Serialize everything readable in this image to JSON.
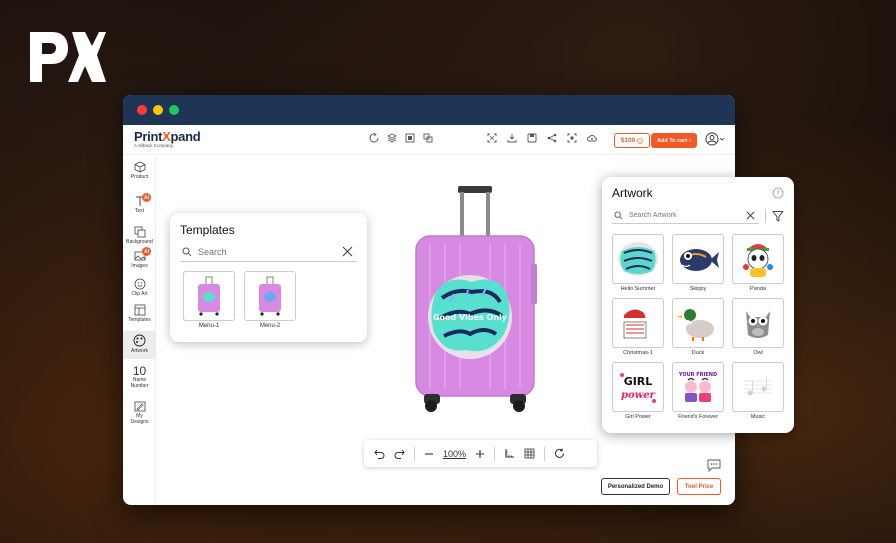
{
  "brand": {
    "name_prefix": "Print",
    "name_x": "X",
    "name_suffix": "pand",
    "sub": "A Silback Company",
    "accent": "#f15a24",
    "navy": "#1e3556"
  },
  "toolbar": {
    "price": "$100",
    "add_to_cart": "Add To cart"
  },
  "sidebar": {
    "items": [
      {
        "label": "Product",
        "icon": "cube-icon"
      },
      {
        "label": "Text",
        "icon": "text-icon"
      },
      {
        "label": "Background",
        "icon": "background-icon"
      },
      {
        "label": "Images",
        "icon": "image-icon"
      },
      {
        "label": "Clip Art",
        "icon": "smiley-icon"
      },
      {
        "label": "Templates",
        "icon": "template-icon"
      },
      {
        "label": "Artwork",
        "icon": "artwork-icon"
      },
      {
        "label": "Name Number",
        "icon": "number-icon"
      },
      {
        "label": "My Designs",
        "icon": "designs-icon"
      }
    ],
    "ai_badge": "AI",
    "number_glyph": "10"
  },
  "templates_panel": {
    "title": "Templates",
    "search_placeholder": "Search",
    "items": [
      {
        "label": "Menu-1"
      },
      {
        "label": "Menu-2"
      }
    ]
  },
  "artwork_panel": {
    "title": "Artwork",
    "search_placeholder": "Search Artwork",
    "items": [
      {
        "label": "Hello Summer",
        "icon": "graffiti-art-icon"
      },
      {
        "label": "Skippy",
        "icon": "fish-icon"
      },
      {
        "label": "Panda",
        "icon": "panda-icon"
      },
      {
        "label": "Christmas-1",
        "icon": "christmas-icon"
      },
      {
        "label": "Duck",
        "icon": "duck-icon"
      },
      {
        "label": "Owl",
        "icon": "owl-icon"
      },
      {
        "label": "Girl Power",
        "icon": "girl-power-icon"
      },
      {
        "label": "Friend's Forever",
        "icon": "friends-icon"
      },
      {
        "label": "Music",
        "icon": "music-icon"
      }
    ],
    "thumb_text": {
      "girl_power": "GIRL power",
      "friends": "YOUR FRIEND"
    }
  },
  "canvas": {
    "zoom": "100%",
    "artwork_text": "Good Vibes Only"
  },
  "footer": {
    "demo_button": "Personalized Demo",
    "tool_price_button": "Tool Price"
  }
}
